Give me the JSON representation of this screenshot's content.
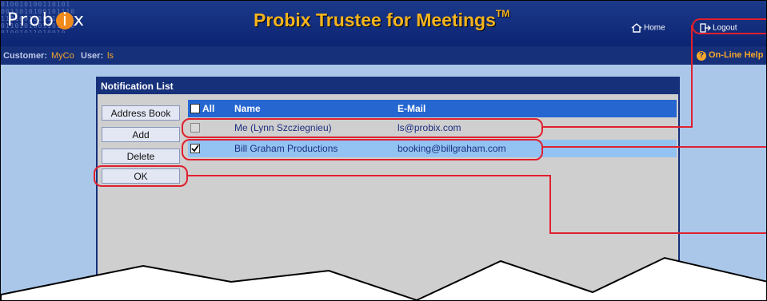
{
  "app": {
    "logo": [
      "Prob",
      "i",
      "x"
    ],
    "title": "Probix Trustee for Meetings",
    "trademark": "TM",
    "nav": {
      "home": "Home",
      "logout": "Logout",
      "help": "On-Line Help"
    }
  },
  "session": {
    "customer_label": "Customer:",
    "customer_value": "MyCo",
    "user_label": "User:",
    "user_value": "ls"
  },
  "dialog": {
    "title": "Notification List",
    "buttons": {
      "address_book": "Address Book",
      "add": "Add",
      "delete": "Delete",
      "ok": "OK"
    },
    "list": {
      "all_label": "All",
      "columns": {
        "name": "Name",
        "email": "E-Mail"
      },
      "rows": [
        {
          "name": "Me (Lynn Szcziegnieu)",
          "email": "ls@probix.com",
          "checked": false,
          "disabled": true
        },
        {
          "name": "Bill Graham Productions",
          "email": "booking@billgraham.com",
          "checked": true,
          "disabled": false
        }
      ]
    }
  },
  "colors": {
    "header_bg": "#1b3a8a",
    "title_text": "#f6b41e",
    "accent_orange": "#f4a72a",
    "list_header_bg": "#2566d1",
    "selected_row_bg": "#92c3f2",
    "callout_red": "#e0202e"
  },
  "icons": {
    "home": "house-icon",
    "logout": "door-exit-icon",
    "help": "question-circle-icon",
    "checkbox_checked": "checkmark-icon"
  }
}
